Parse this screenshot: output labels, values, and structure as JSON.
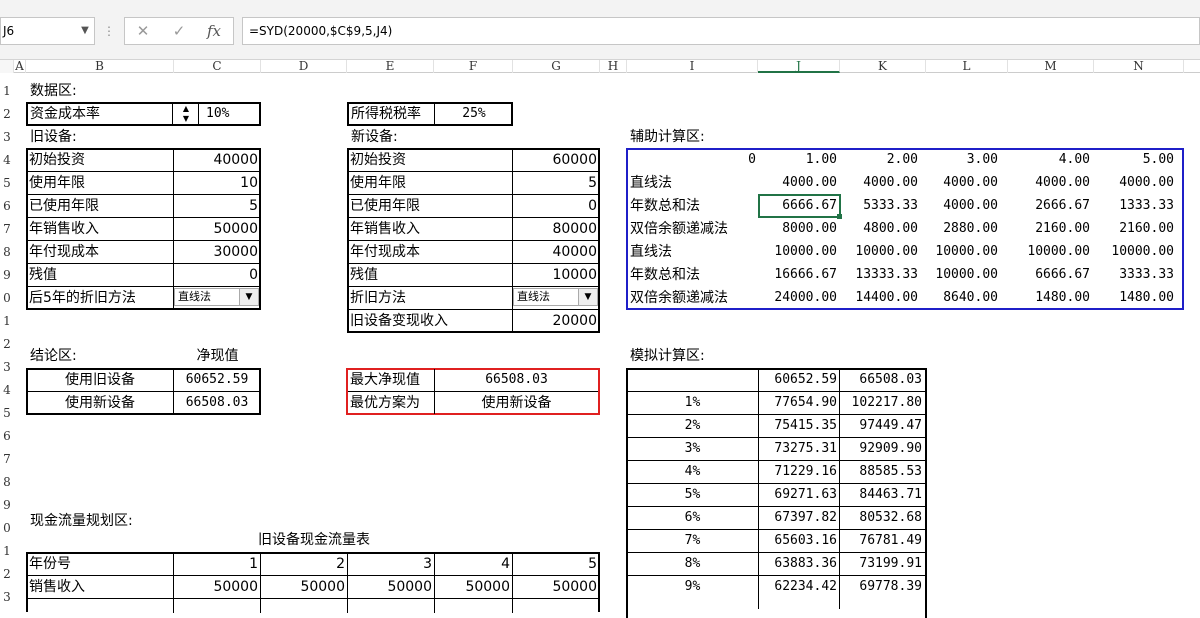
{
  "formula_bar": {
    "name_box": "J6",
    "formula": "=SYD(20000,$C$9,5,J4)"
  },
  "columns": [
    "A",
    "B",
    "C",
    "D",
    "E",
    "F",
    "G",
    "H",
    "I",
    "J",
    "K",
    "L",
    "M",
    "N"
  ],
  "rows": [
    "1",
    "2",
    "3",
    "4",
    "5",
    "6",
    "7",
    "8",
    "9",
    "0",
    "1",
    "2",
    "3",
    "4",
    "5",
    "6",
    "7",
    "8",
    "9",
    "0",
    "1",
    "2",
    "3"
  ],
  "data_area": {
    "title": "数据区:",
    "cost_of_capital_label": "资金成本率",
    "cost_of_capital": "10%",
    "tax_rate_label": "所得税税率",
    "tax_rate": "25%",
    "old": {
      "title": "旧设备:",
      "rows": [
        {
          "label": "初始投资",
          "value": "40000"
        },
        {
          "label": "使用年限",
          "value": "10"
        },
        {
          "label": "已使用年限",
          "value": "5"
        },
        {
          "label": "年销售收入",
          "value": "50000"
        },
        {
          "label": "年付现成本",
          "value": "30000"
        },
        {
          "label": "残值",
          "value": "0"
        }
      ],
      "method_label": "后5年的折旧方法",
      "method": "直线法"
    },
    "new": {
      "title": "新设备:",
      "rows": [
        {
          "label": "初始投资",
          "value": "60000"
        },
        {
          "label": "使用年限",
          "value": "5"
        },
        {
          "label": "已使用年限",
          "value": "0"
        },
        {
          "label": "年销售收入",
          "value": "80000"
        },
        {
          "label": "年付现成本",
          "value": "40000"
        },
        {
          "label": "残值",
          "value": "10000"
        }
      ],
      "method_label": "折旧方法",
      "method": "直线法",
      "salvage_label": "旧设备变现收入",
      "salvage": "20000"
    }
  },
  "aux": {
    "title": "辅助计算区:",
    "header": [
      "0",
      "1.00",
      "2.00",
      "3.00",
      "4.00",
      "5.00"
    ],
    "rows": [
      {
        "label": "直线法",
        "v": [
          "4000.00",
          "4000.00",
          "4000.00",
          "4000.00",
          "4000.00"
        ]
      },
      {
        "label": "年数总和法",
        "v": [
          "6666.67",
          "5333.33",
          "4000.00",
          "2666.67",
          "1333.33"
        ]
      },
      {
        "label": "双倍余额递减法",
        "v": [
          "8000.00",
          "4800.00",
          "2880.00",
          "2160.00",
          "2160.00"
        ]
      },
      {
        "label": "直线法",
        "v": [
          "10000.00",
          "10000.00",
          "10000.00",
          "10000.00",
          "10000.00"
        ]
      },
      {
        "label": "年数总和法",
        "v": [
          "16666.67",
          "13333.33",
          "10000.00",
          "6666.67",
          "3333.33"
        ]
      },
      {
        "label": "双倍余额递减法",
        "v": [
          "24000.00",
          "14400.00",
          "8640.00",
          "1480.00",
          "1480.00"
        ]
      }
    ]
  },
  "conclusion": {
    "title": "结论区:",
    "npv_header": "净现值",
    "rows": [
      {
        "label": "使用旧设备",
        "value": "60652.59"
      },
      {
        "label": "使用新设备",
        "value": "66508.03"
      }
    ],
    "max_label": "最大净现值",
    "max_value": "66508.03",
    "best_label": "最优方案为",
    "best_value": "使用新设备"
  },
  "sim": {
    "title": "模拟计算区:",
    "rows": [
      {
        "rate": "",
        "a": "60652.59",
        "b": "66508.03"
      },
      {
        "rate": "1%",
        "a": "77654.90",
        "b": "102217.80"
      },
      {
        "rate": "2%",
        "a": "75415.35",
        "b": "97449.47"
      },
      {
        "rate": "3%",
        "a": "73275.31",
        "b": "92909.90"
      },
      {
        "rate": "4%",
        "a": "71229.16",
        "b": "88585.53"
      },
      {
        "rate": "5%",
        "a": "69271.63",
        "b": "84463.71"
      },
      {
        "rate": "6%",
        "a": "67397.82",
        "b": "80532.68"
      },
      {
        "rate": "7%",
        "a": "65603.16",
        "b": "76781.49"
      },
      {
        "rate": "8%",
        "a": "63883.36",
        "b": "73199.91"
      },
      {
        "rate": "9%",
        "a": "62234.42",
        "b": "69778.39"
      }
    ]
  },
  "cashflow": {
    "title": "现金流量规划区:",
    "table_title": "旧设备现金流量表",
    "year_label": "年份号",
    "years": [
      "1",
      "2",
      "3",
      "4",
      "5"
    ],
    "sales_label": "销售收入",
    "sales": [
      "50000",
      "50000",
      "50000",
      "50000",
      "50000"
    ]
  }
}
